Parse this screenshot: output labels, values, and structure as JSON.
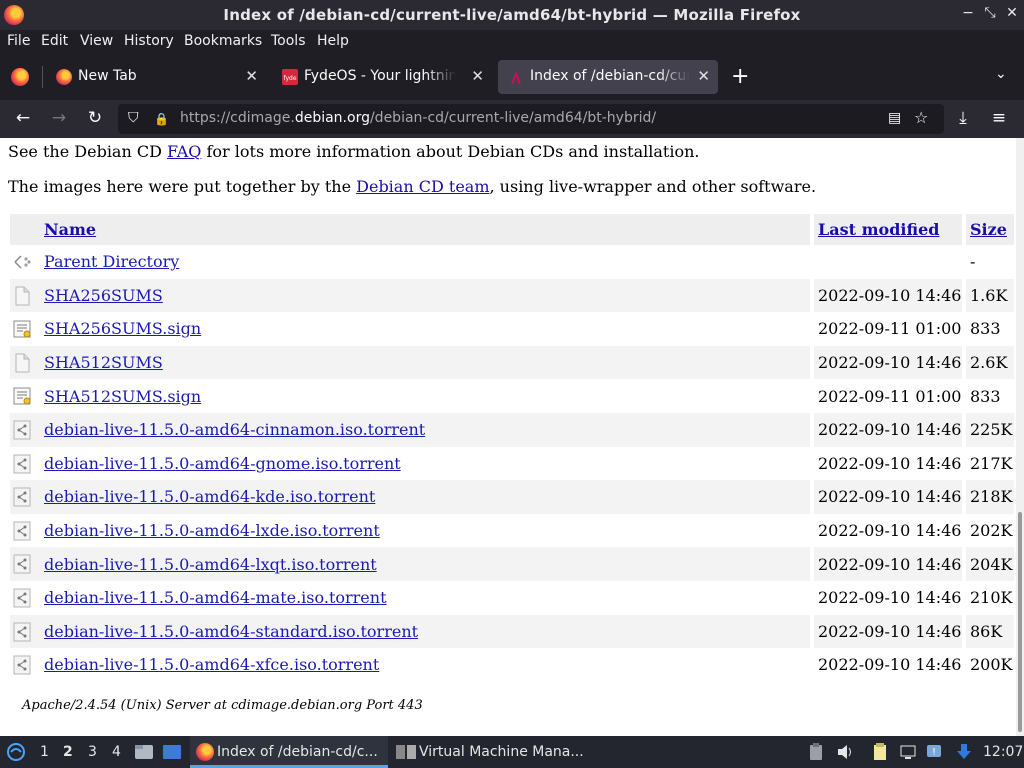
{
  "window": {
    "title": "Index of /debian-cd/current-live/amd64/bt-hybrid — Mozilla Firefox",
    "controls": {
      "minimize": "−",
      "restore": "⤡",
      "close": "✕"
    }
  },
  "menu": [
    "File",
    "Edit",
    "View",
    "History",
    "Bookmarks",
    "Tools",
    "Help"
  ],
  "tabs": [
    {
      "label": "New Tab",
      "close": "✕"
    },
    {
      "label": "FydeOS - Your lightning-fast",
      "close": "✕"
    },
    {
      "label": "Index of /debian-cd/current-live",
      "close": "✕"
    }
  ],
  "tabstrip": {
    "new_tab": "+",
    "list_all": "⌄"
  },
  "nav": {
    "back": "←",
    "forward": "→",
    "reload": "↻",
    "url_prefix": "https://cdimage.",
    "url_domain": "debian.org",
    "url_path": "/debian-cd/current-live/amd64/bt-hybrid/",
    "shield": "⛉",
    "lock": "🔒",
    "reader": "▤",
    "bookmark": "☆",
    "downloads": "⤓",
    "menu": "≡"
  },
  "page": {
    "intro1_before": "See the Debian CD ",
    "intro1_link": "FAQ",
    "intro1_after": " for lots more information about Debian CDs and installation.",
    "intro2_before": "The images here were put together by the ",
    "intro2_link": "Debian CD team",
    "intro2_after": ", using live-wrapper and other software.",
    "headers": {
      "name": "Name",
      "modified": "Last modified",
      "size": "Size"
    },
    "rows": [
      {
        "icon": "back",
        "name": "Parent Directory",
        "modified": "",
        "size": "-"
      },
      {
        "icon": "text",
        "name": "SHA256SUMS",
        "modified": "2022-09-10 14:46",
        "size": "1.6K"
      },
      {
        "icon": "sign",
        "name": "SHA256SUMS.sign",
        "modified": "2022-09-11 01:00",
        "size": "833"
      },
      {
        "icon": "text",
        "name": "SHA512SUMS",
        "modified": "2022-09-10 14:46",
        "size": "2.6K"
      },
      {
        "icon": "sign",
        "name": "SHA512SUMS.sign",
        "modified": "2022-09-11 01:00",
        "size": "833"
      },
      {
        "icon": "torrent",
        "name": "debian-live-11.5.0-amd64-cinnamon.iso.torrent",
        "modified": "2022-09-10 14:46",
        "size": "225K"
      },
      {
        "icon": "torrent",
        "name": "debian-live-11.5.0-amd64-gnome.iso.torrent",
        "modified": "2022-09-10 14:46",
        "size": "217K"
      },
      {
        "icon": "torrent",
        "name": "debian-live-11.5.0-amd64-kde.iso.torrent",
        "modified": "2022-09-10 14:46",
        "size": "218K"
      },
      {
        "icon": "torrent",
        "name": "debian-live-11.5.0-amd64-lxde.iso.torrent",
        "modified": "2022-09-10 14:46",
        "size": "202K"
      },
      {
        "icon": "torrent",
        "name": "debian-live-11.5.0-amd64-lxqt.iso.torrent",
        "modified": "2022-09-10 14:46",
        "size": "204K"
      },
      {
        "icon": "torrent",
        "name": "debian-live-11.5.0-amd64-mate.iso.torrent",
        "modified": "2022-09-10 14:46",
        "size": "210K"
      },
      {
        "icon": "torrent",
        "name": "debian-live-11.5.0-amd64-standard.iso.torrent",
        "modified": "2022-09-10 14:46",
        "size": "86K"
      },
      {
        "icon": "torrent",
        "name": "debian-live-11.5.0-amd64-xfce.iso.torrent",
        "modified": "2022-09-10 14:46",
        "size": "200K"
      }
    ],
    "footer": "Apache/2.4.54 (Unix) Server at cdimage.debian.org Port 443"
  },
  "taskbar": {
    "workspaces": [
      "1",
      "2",
      "3",
      "4"
    ],
    "current_workspace": "2",
    "tasks": [
      {
        "label": "Index of /debian-cd/c...",
        "active": true
      },
      {
        "label": "Virtual Machine Mana...",
        "active": false
      }
    ],
    "clock": "12:07"
  }
}
